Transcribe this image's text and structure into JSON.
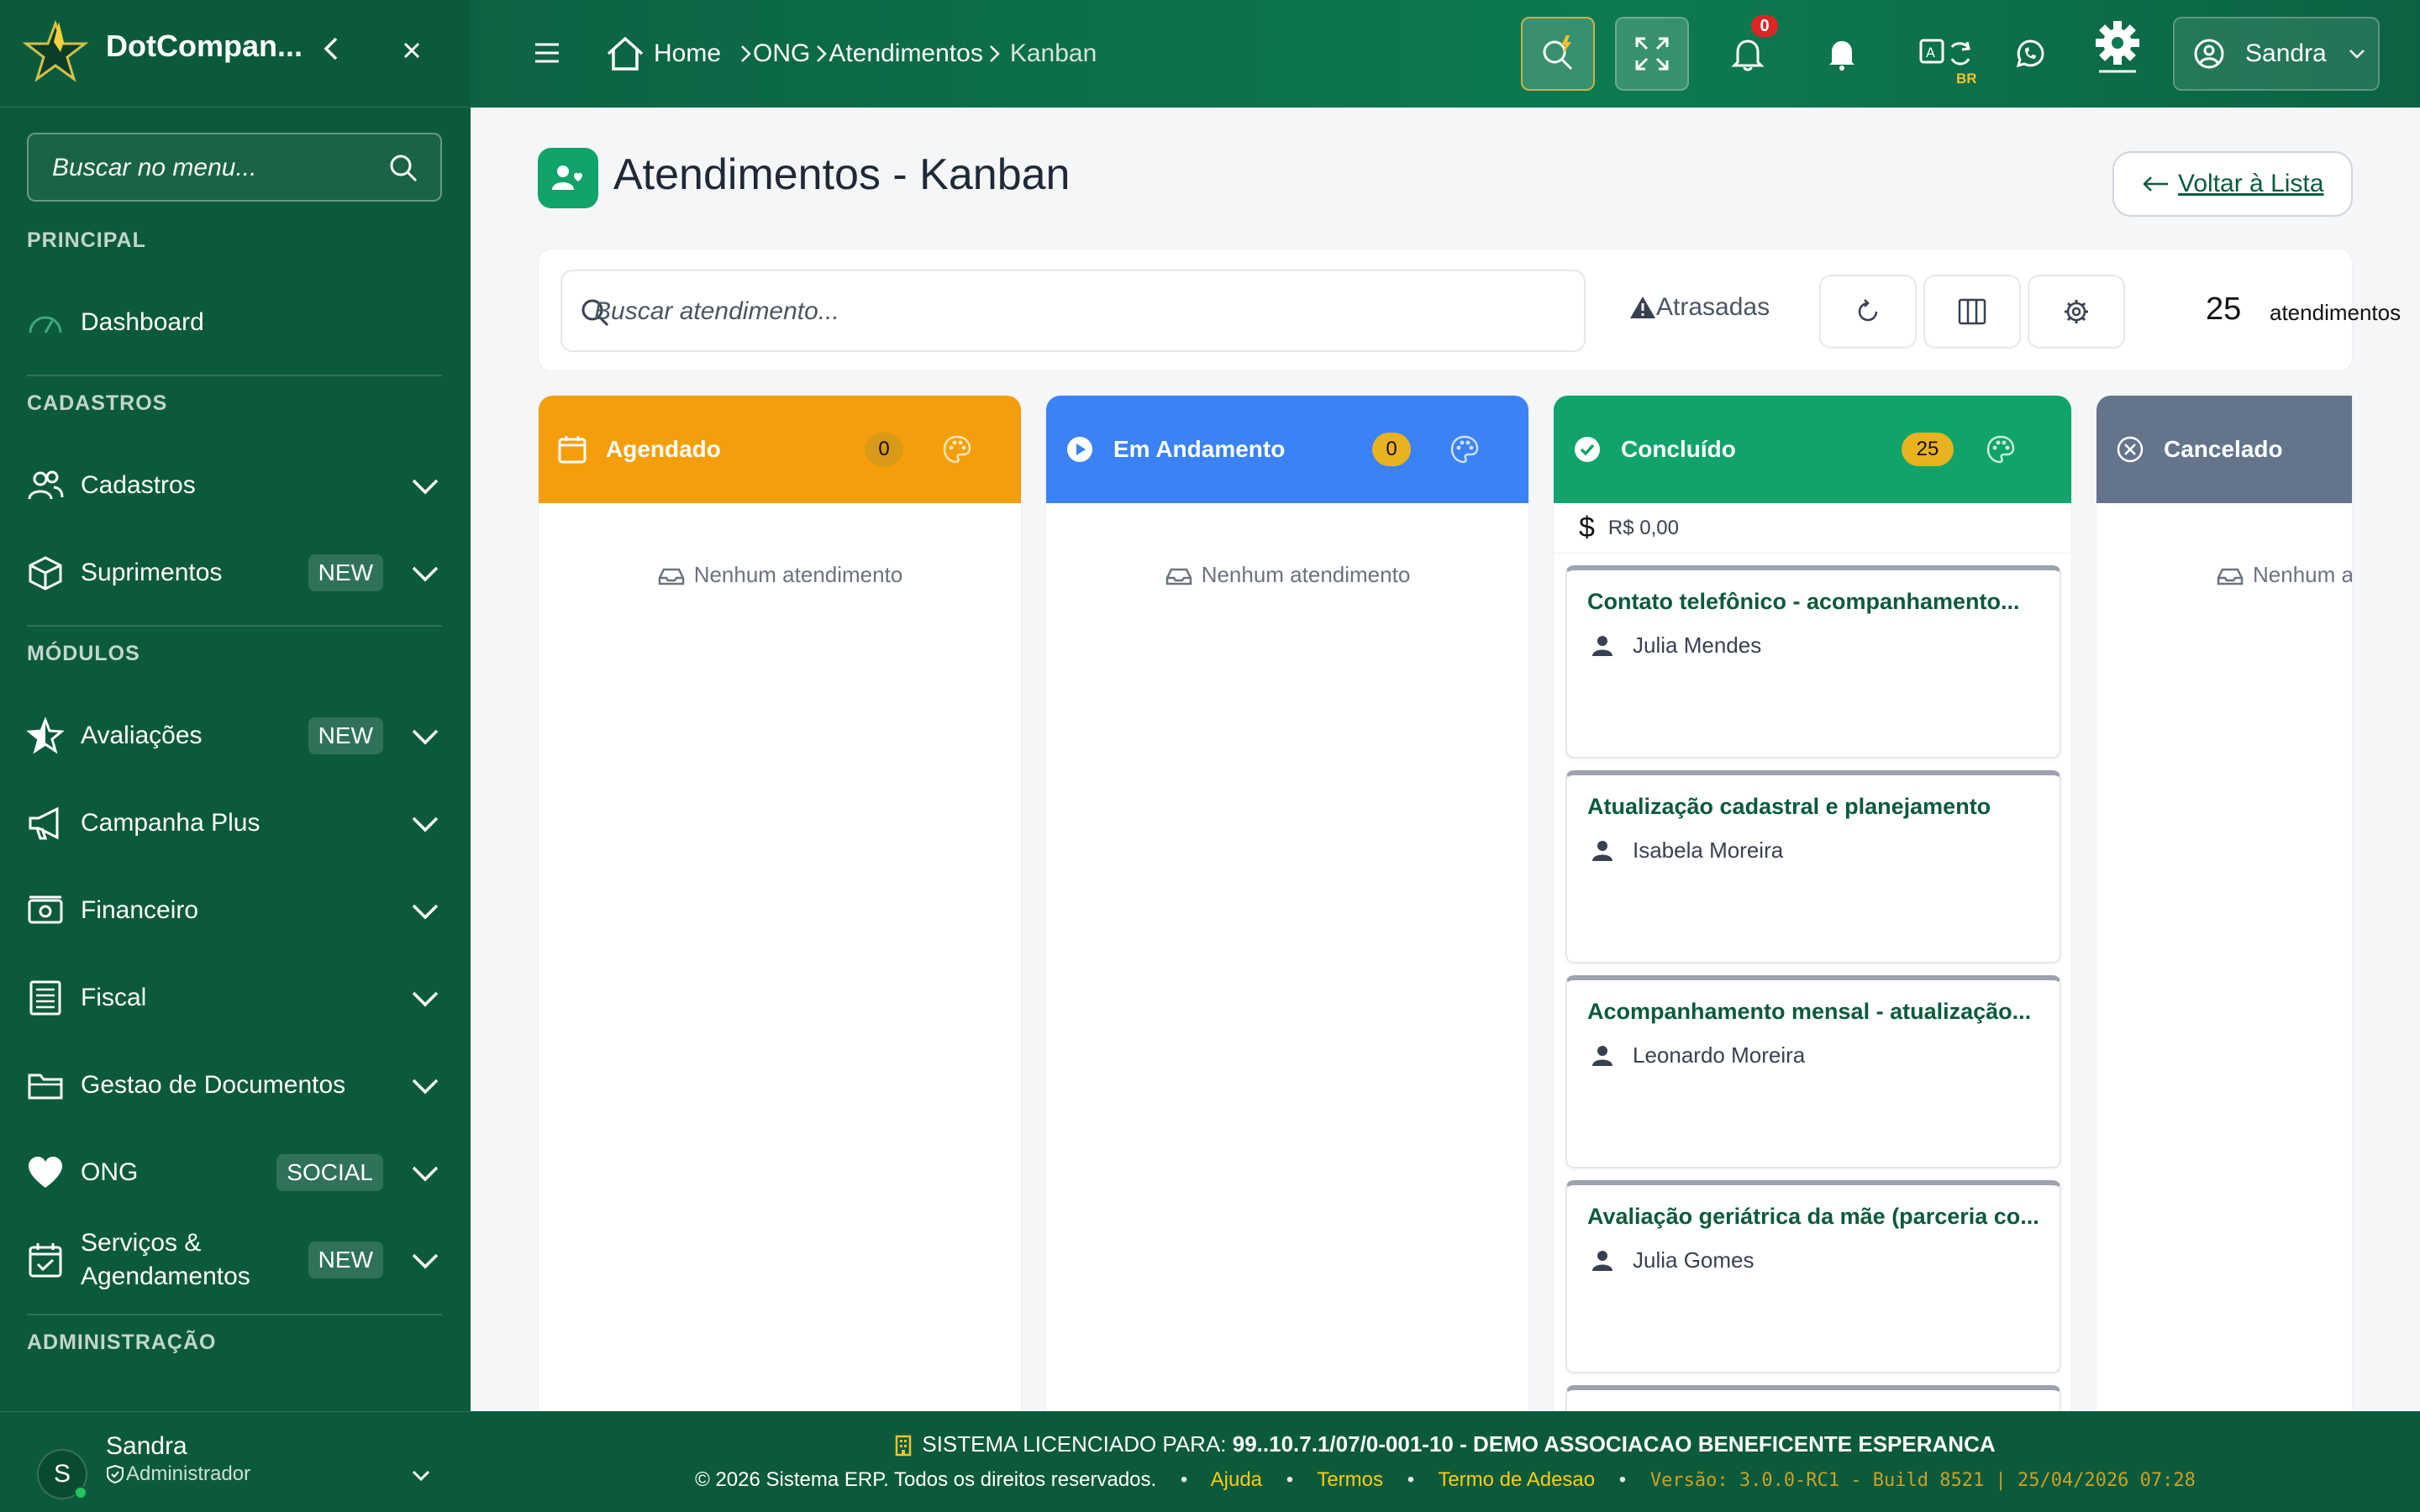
{
  "sidebar": {
    "brand": "DotCompan...",
    "search_placeholder": "Buscar no menu...",
    "sections": {
      "principal": "PRINCIPAL",
      "cadastros": "CADASTROS",
      "modulos": "MÓDULOS",
      "administracao": "ADMINISTRAÇÃO"
    },
    "items": {
      "dashboard": {
        "label": "Dashboard",
        "icon": "gauge-icon"
      },
      "cadastros": {
        "label": "Cadastros",
        "icon": "users-icon"
      },
      "suprimentos": {
        "label": "Suprimentos",
        "badge": "NEW",
        "icon": "box-icon"
      },
      "avaliacoes": {
        "label": "Avaliações",
        "badge": "NEW",
        "icon": "star-icon"
      },
      "campanha": {
        "label": "Campanha Plus",
        "icon": "megaphone-icon"
      },
      "financeiro": {
        "label": "Financeiro",
        "icon": "money-icon"
      },
      "fiscal": {
        "label": "Fiscal",
        "icon": "receipt-icon"
      },
      "documentos": {
        "label": "Gestao de Documentos",
        "icon": "folder-icon"
      },
      "ong": {
        "label": "ONG",
        "badge": "SOCIAL",
        "icon": "heart-icon"
      },
      "servicos": {
        "label": "Serviços & Agendamentos",
        "badge": "NEW",
        "icon": "calendar-check-icon"
      }
    },
    "user": {
      "initial": "S",
      "name": "Sandra",
      "role": "Administrador"
    }
  },
  "topbar": {
    "breadcrumb": {
      "home": "Home",
      "ong": "ONG",
      "atendimentos": "Atendimentos",
      "current": "Kanban"
    },
    "notifications_count": "0",
    "lang_badge": "BR",
    "user_name": "Sandra"
  },
  "page": {
    "title": "Atendimentos - Kanban",
    "back_label": "Voltar à Lista"
  },
  "toolbar": {
    "search_placeholder": "Buscar atendimento...",
    "atrasadas_label": "Atrasadas",
    "count": "25",
    "count_label": "atendimentos"
  },
  "columns": [
    {
      "title": "Agendado",
      "count": "0",
      "color": "#f59e0b",
      "empty": "Nenhum atendimento"
    },
    {
      "title": "Em Andamento",
      "count": "0",
      "color": "#3b82f6",
      "empty": "Nenhum atendimento"
    },
    {
      "title": "Concluído",
      "count": "25",
      "color": "#10a36a",
      "total": "R$ 0,00",
      "cards": [
        {
          "title": "Contato telefônico - acompanhamento...",
          "person": "Julia Mendes"
        },
        {
          "title": "Atualização cadastral e planejamento",
          "person": "Isabela Moreira"
        },
        {
          "title": "Acompanhamento mensal - atualização...",
          "person": "Leonardo Moreira"
        },
        {
          "title": "Avaliação geriátrica da mãe (parceria co...",
          "person": "Julia Gomes"
        }
      ]
    },
    {
      "title": "Cancelado",
      "color": "#64748b",
      "empty": "Nenhum at"
    }
  ],
  "footer": {
    "license_prefix": "SISTEMA LICENCIADO PARA:",
    "license_value": "99..10.7.1/07/0-001-10 - DEMO ASSOCIACAO BENEFICENTE ESPERANCA",
    "copyright": "© 2026 Sistema ERP. Todos os direitos reservados.",
    "help": "Ajuda",
    "terms": "Termos",
    "adhesion": "Termo de Adesao",
    "version": "Versão: 3.0.0-RC1 - Build 8521 | 25/04/2026 07:28"
  }
}
